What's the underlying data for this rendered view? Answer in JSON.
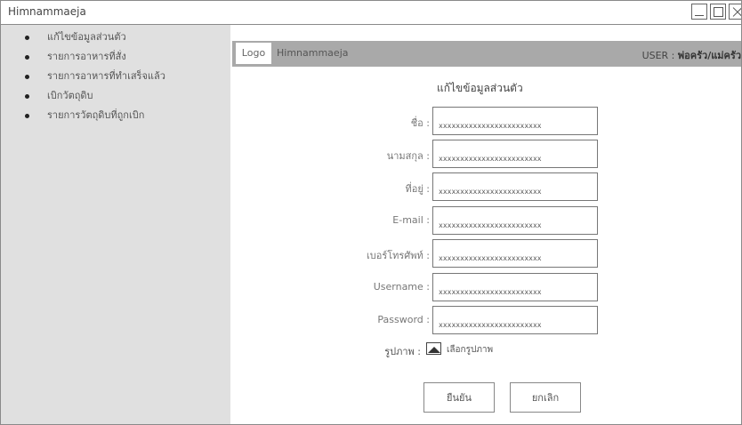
{
  "window": {
    "title": "Himnammaeja"
  },
  "sidebar": {
    "items": [
      {
        "label": "แก้ไขข้อมูลส่วนตัว"
      },
      {
        "label": "รายการอาหารที่สั่ง"
      },
      {
        "label": "รายการอาหารที่ทำเสร็จแล้ว"
      },
      {
        "label": "เบิกวัตถุดิบ"
      },
      {
        "label": "รายการวัตถุดิบที่ถูกเบิก"
      }
    ]
  },
  "header": {
    "logo": "Logo",
    "app_name": "Himnammaeja",
    "user_prefix": "USER : ",
    "user_name": "พ่อครัว/แม่ครัว"
  },
  "form": {
    "title": "แก้ไขข้อมูลส่วนตัว",
    "fields": [
      {
        "label": "ชื่อ :",
        "value": "xxxxxxxxxxxxxxxxxxxxxxxx"
      },
      {
        "label": "นามสกุล :",
        "value": "xxxxxxxxxxxxxxxxxxxxxxxx"
      },
      {
        "label": "ที่อยู่ :",
        "value": "xxxxxxxxxxxxxxxxxxxxxxxx"
      },
      {
        "label": "E-mail :",
        "value": "xxxxxxxxxxxxxxxxxxxxxxxx"
      },
      {
        "label": "เบอร์โทรศัพท์ :",
        "value": "xxxxxxxxxxxxxxxxxxxxxxxx"
      },
      {
        "label": "Username :",
        "value": "xxxxxxxxxxxxxxxxxxxxxxxx"
      },
      {
        "label": "Password :",
        "value": "xxxxxxxxxxxxxxxxxxxxxxxx"
      }
    ],
    "photo_label": "รูปภาพ :",
    "photo_action": "เลือกรูปภาพ",
    "confirm_label": "ยืนยัน",
    "cancel_label": "ยกเลิก"
  }
}
